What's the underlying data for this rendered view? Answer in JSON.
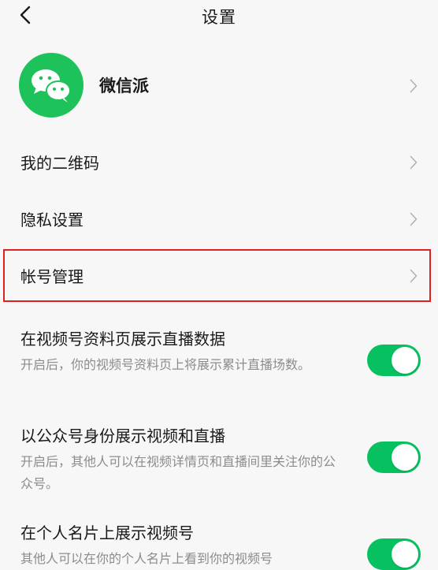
{
  "header": {
    "title": "设置"
  },
  "profile": {
    "name": "微信派"
  },
  "menu": [
    {
      "label": "我的二维码"
    },
    {
      "label": "隐私设置"
    },
    {
      "label": "帐号管理"
    }
  ],
  "settings": [
    {
      "title": "在视频号资料页展示直播数据",
      "desc": "开启后，你的视频号资料页上将展示累计直播场数。",
      "enabled": true
    },
    {
      "title": "以公众号身份展示视频和直播",
      "desc": "开启后，其他人可以在视频详情页和直播间里关注你的公众号。",
      "enabled": true
    },
    {
      "title": "在个人名片上展示视频号",
      "desc": "其他人可以在你的个人名片上看到你的视频号",
      "enabled": true
    }
  ],
  "colors": {
    "accent": "#07c160",
    "avatar": "#1ec25a",
    "highlight": "#e02020"
  }
}
